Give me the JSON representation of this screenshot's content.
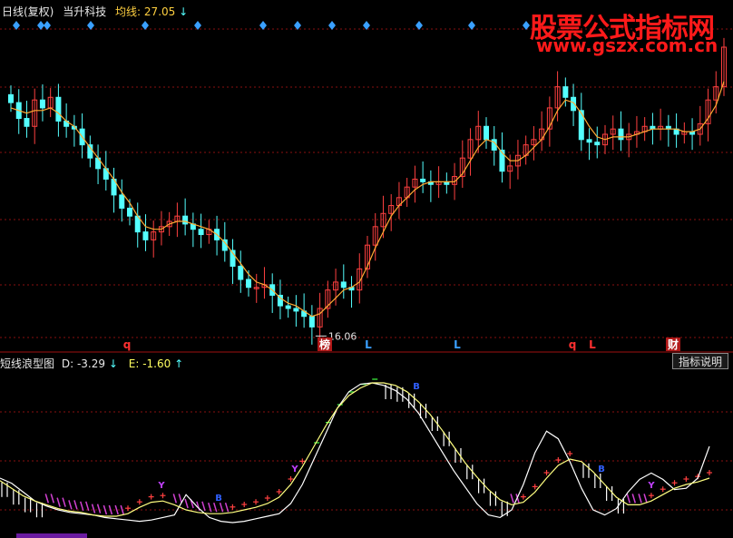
{
  "top_panel": {
    "title": "日线(复权)",
    "stock_name": "当升科技",
    "ma_label": "均线:",
    "ma_value": "27.05",
    "ma_arrow": "↓",
    "low_price_label": "16.06"
  },
  "bottom_panel": {
    "title": "短线浪型图",
    "d_label": "D:",
    "d_value": "-3.29",
    "d_arrow": "↓",
    "e_label": "E:",
    "e_value": "-1.60",
    "e_arrow": "↑",
    "button_label": "指标说明"
  },
  "watermark": {
    "line1": "股票公式指标网",
    "line2": "www.gszx.com.cn"
  },
  "signals": [
    {
      "text": "q",
      "color": "#ff3030"
    },
    {
      "text": "榜",
      "color": "#ffffff"
    },
    {
      "text": "L",
      "color": "#3aa0ff"
    },
    {
      "text": "L",
      "color": "#3aa0ff"
    },
    {
      "text": "q",
      "color": "#ff3030"
    },
    {
      "text": "L",
      "color": "#ff3030"
    },
    {
      "text": "财",
      "color": "#ffffff"
    }
  ],
  "osc_markers": [
    "Y",
    "B",
    "Y",
    "B",
    "B",
    "Y"
  ],
  "colors": {
    "up": "#ff4040",
    "down": "#54ffff",
    "ma": "#ffaa33",
    "grid": "#8a1010",
    "white_line": "#ffffff",
    "yellow_line": "#ffff80",
    "hatch": "#d040d0",
    "green_dash": "#40ff40",
    "plus": "#ff4040"
  },
  "chart_data": {
    "type": "candlestick",
    "close": [
      24.8,
      24.2,
      23.9,
      24.9,
      24.6,
      25.0,
      24.1,
      23.9,
      23.8,
      23.2,
      22.7,
      22.3,
      21.9,
      21.3,
      20.8,
      20.5,
      19.9,
      19.6,
      19.9,
      20.1,
      20.3,
      20.5,
      20.2,
      20.0,
      19.8,
      20.0,
      19.6,
      19.2,
      18.6,
      18.1,
      17.8,
      17.8,
      17.9,
      17.5,
      17.1,
      17.0,
      16.9,
      16.7,
      16.3,
      17.0,
      17.7,
      18.0,
      17.8,
      17.7,
      18.5,
      19.4,
      20.1,
      20.6,
      20.9,
      21.2,
      21.6,
      21.9,
      21.8,
      21.7,
      21.8,
      21.7,
      22.0,
      22.7,
      23.4,
      23.9,
      23.4,
      23.0,
      22.2,
      22.4,
      22.8,
      23.2,
      23.4,
      23.8,
      24.6,
      25.4,
      25.0,
      24.5,
      23.4,
      23.3,
      23.2,
      23.6,
      23.8,
      23.4,
      23.6,
      23.7,
      23.9,
      23.8,
      23.9,
      23.8,
      23.6,
      23.7,
      23.6,
      24.0,
      24.9,
      25.4,
      26.9
    ],
    "ma": [
      24.6,
      24.5,
      24.4,
      24.5,
      24.5,
      24.6,
      24.4,
      24.1,
      23.9,
      23.5,
      23.1,
      22.7,
      22.3,
      21.9,
      21.4,
      21.0,
      20.5,
      20.1,
      20.0,
      20.0,
      20.2,
      20.3,
      20.3,
      20.2,
      20.1,
      20.0,
      19.8,
      19.5,
      19.1,
      18.7,
      18.3,
      18.0,
      17.9,
      17.7,
      17.4,
      17.2,
      17.1,
      16.9,
      16.7,
      16.8,
      17.1,
      17.4,
      17.7,
      17.8,
      18.0,
      18.6,
      19.3,
      19.9,
      20.5,
      20.9,
      21.2,
      21.5,
      21.7,
      21.8,
      21.8,
      21.8,
      21.8,
      22.1,
      22.6,
      23.1,
      23.4,
      23.3,
      22.9,
      22.6,
      22.6,
      22.8,
      23.1,
      23.4,
      23.9,
      24.5,
      24.9,
      24.8,
      24.4,
      23.9,
      23.5,
      23.4,
      23.5,
      23.5,
      23.5,
      23.6,
      23.7,
      23.8,
      23.8,
      23.8,
      23.8,
      23.7,
      23.7,
      23.8,
      24.2,
      24.7,
      25.6
    ],
    "yaxis": {
      "min": 15.9,
      "max": 28.0
    },
    "low_mark": 16.06,
    "oscillator": {
      "D": [
        -0.5,
        -0.9,
        -1.6,
        -2.3,
        -2.7,
        -3.0,
        -3.2,
        -3.3,
        -3.4,
        -3.6,
        -3.7,
        -3.8,
        -3.9,
        -3.8,
        -3.6,
        -3.4,
        -1.8,
        -2.8,
        -3.6,
        -3.9,
        -4.0,
        -3.9,
        -3.7,
        -3.5,
        -3.3,
        -2.5,
        -1.0,
        1.0,
        3.0,
        5.0,
        6.3,
        6.9,
        7.0,
        6.8,
        6.4,
        5.7,
        4.6,
        3.1,
        1.6,
        0.1,
        -1.2,
        -2.5,
        -3.4,
        -3.6,
        -3.0,
        -1.0,
        1.5,
        3.2,
        2.6,
        0.8,
        -1.3,
        -3.0,
        -3.4,
        -2.9,
        -1.6,
        -0.6,
        -0.1,
        -0.6,
        -1.4,
        -1.3,
        -0.5,
        2.0
      ],
      "E": [
        -0.7,
        -1.3,
        -1.9,
        -2.3,
        -2.6,
        -2.9,
        -3.1,
        -3.2,
        -3.4,
        -3.5,
        -3.5,
        -3.3,
        -2.8,
        -2.4,
        -2.3,
        -2.6,
        -3.0,
        -3.2,
        -3.3,
        -3.3,
        -3.2,
        -3.0,
        -2.8,
        -2.5,
        -2.0,
        -1.0,
        0.4,
        2.0,
        3.6,
        5.0,
        6.0,
        6.6,
        7.0,
        7.0,
        6.8,
        6.3,
        5.5,
        4.5,
        3.3,
        2.0,
        0.7,
        -0.4,
        -1.4,
        -2.2,
        -2.6,
        -2.4,
        -1.6,
        -0.5,
        0.5,
        1.0,
        0.8,
        0.0,
        -1.0,
        -2.0,
        -2.6,
        -2.6,
        -2.3,
        -1.8,
        -1.3,
        -1.0,
        -0.8,
        -0.5
      ],
      "yaxis": {
        "min": -5.0,
        "max": 8.0
      }
    }
  }
}
